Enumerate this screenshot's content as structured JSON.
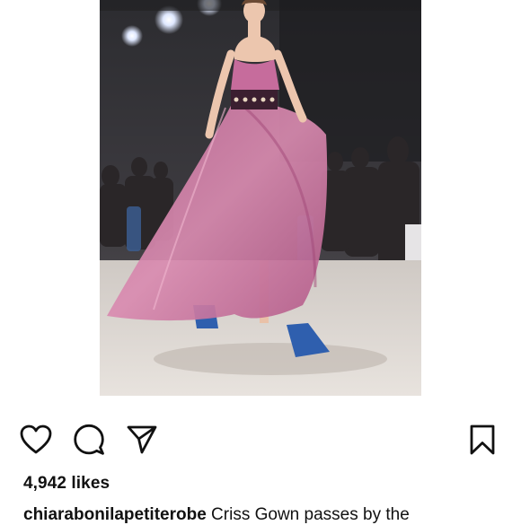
{
  "post": {
    "image_alt": "Model walking the runway in a flowing pink gown with blue heels"
  },
  "actions": {
    "like_icon": "heart-icon",
    "comment_icon": "comment-icon",
    "share_icon": "send-icon",
    "save_icon": "bookmark-icon"
  },
  "likes": {
    "text": "4,942 likes"
  },
  "caption": {
    "username": "chiarabonilapetiterobe",
    "text": " Criss Gown passes by the"
  }
}
